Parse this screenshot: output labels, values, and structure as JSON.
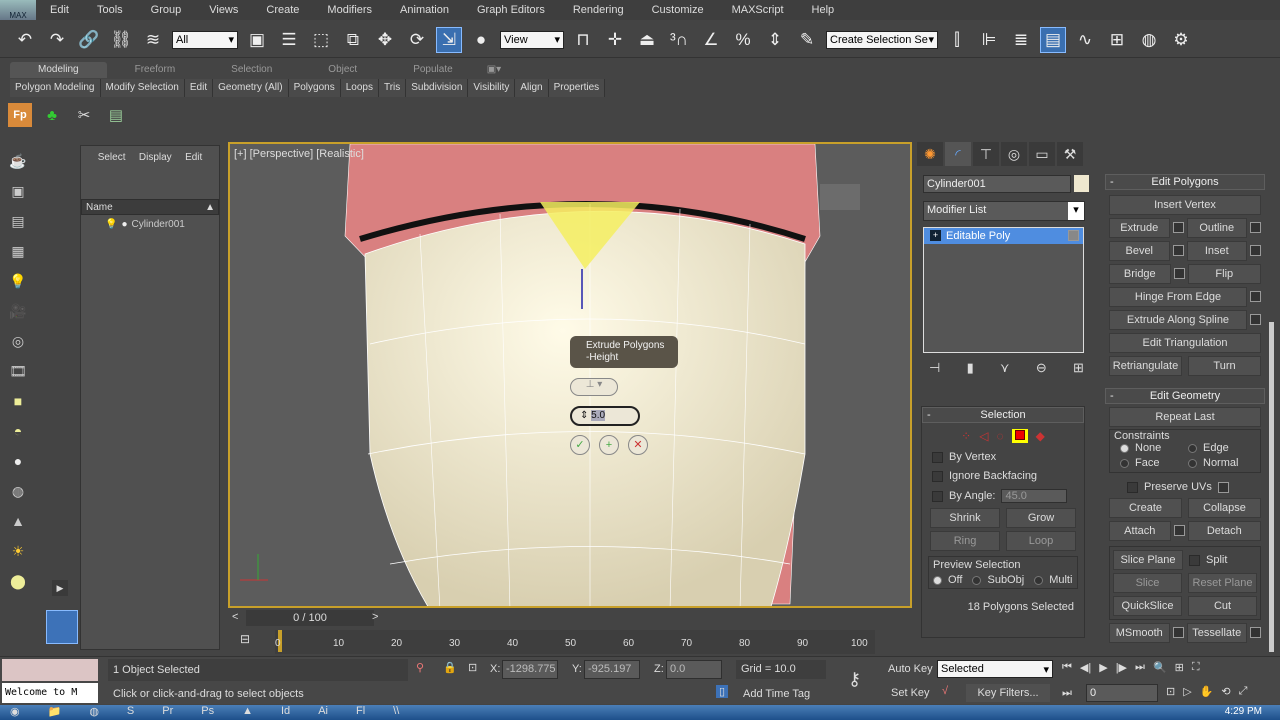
{
  "app": {
    "logo": "MAX"
  },
  "menu": [
    "Edit",
    "Tools",
    "Group",
    "Views",
    "Create",
    "Modifiers",
    "Animation",
    "Graph Editors",
    "Rendering",
    "Customize",
    "MAXScript",
    "Help"
  ],
  "toolbar": {
    "selection_filter": "All",
    "ref_coord": "View",
    "named_selection": "Create Selection Se"
  },
  "ribbon": {
    "tabs": [
      "Modeling",
      "Freeform",
      "Selection",
      "Object Paint",
      "Populate"
    ],
    "items": [
      "Polygon Modeling",
      "Modify Selection",
      "Edit",
      "Geometry (All)",
      "Polygons",
      "Loops",
      "Tris",
      "Subdivision",
      "Visibility",
      "Align",
      "Properties"
    ]
  },
  "explorer": {
    "tabs": [
      "Select",
      "Display",
      "Edit"
    ],
    "column": "Name",
    "objects": [
      "Cylinder001"
    ]
  },
  "viewport": {
    "label": "[+] [Perspective] [Realistic]",
    "caddy_title": "Extrude Polygons",
    "caddy_sub": "-Height",
    "height_value": "5.0",
    "colors": {
      "cup": "#efe8cf",
      "rim": "#d98080"
    }
  },
  "command_panel": {
    "object_name": "Cylinder001",
    "modifier_list": "Modifier List",
    "stack": [
      "Editable Poly"
    ],
    "selection": {
      "title": "Selection",
      "by_vertex": "By Vertex",
      "ignore_backfacing": "Ignore Backfacing",
      "by_angle": "By Angle:",
      "angle": "45.0",
      "shrink": "Shrink",
      "grow": "Grow",
      "ring": "Ring",
      "loop": "Loop",
      "preview": "Preview Selection",
      "preview_opts": [
        "Off",
        "SubObj",
        "Multi"
      ],
      "status": "18 Polygons Selected"
    },
    "edit_polygons": {
      "title": "Edit Polygons",
      "insert_vertex": "Insert Vertex",
      "extrude": "Extrude",
      "outline": "Outline",
      "bevel": "Bevel",
      "inset": "Inset",
      "bridge": "Bridge",
      "flip": "Flip",
      "hinge": "Hinge From Edge",
      "extrude_spline": "Extrude Along Spline",
      "edit_tri": "Edit Triangulation",
      "retri": "Retriangulate",
      "turn": "Turn"
    },
    "edit_geometry": {
      "title": "Edit Geometry",
      "repeat": "Repeat Last",
      "constraints": "Constraints",
      "c_opts": [
        "None",
        "Edge",
        "Face",
        "Normal"
      ],
      "preserve": "Preserve UVs",
      "create": "Create",
      "collapse": "Collapse",
      "attach": "Attach",
      "detach": "Detach",
      "slice_plane": "Slice Plane",
      "split": "Split",
      "slice": "Slice",
      "reset_plane": "Reset Plane",
      "quickslice": "QuickSlice",
      "cut": "Cut",
      "msmooth": "MSmooth",
      "tessellate": "Tessellate"
    }
  },
  "timeline": {
    "frame": "0 / 100",
    "ticks": [
      "0",
      "10",
      "20",
      "30",
      "40",
      "50",
      "60",
      "70",
      "80",
      "90",
      "100"
    ]
  },
  "status": {
    "listener": "Welcome to M",
    "selected": "1 Object Selected",
    "prompt": "Click or click-and-drag to select objects",
    "x_label": "X:",
    "x": "-1298.775",
    "y_label": "Y:",
    "y": "-925.197",
    "z_label": "Z:",
    "z": "0.0",
    "grid": "Grid = 10.0",
    "add_time_tag": "Add Time Tag",
    "auto_key": "Auto Key",
    "set_key": "Set Key",
    "key_mode": "Selected",
    "key_filters": "Key Filters...",
    "current_frame": "0"
  },
  "taskbar": {
    "time": "4:29 PM"
  }
}
